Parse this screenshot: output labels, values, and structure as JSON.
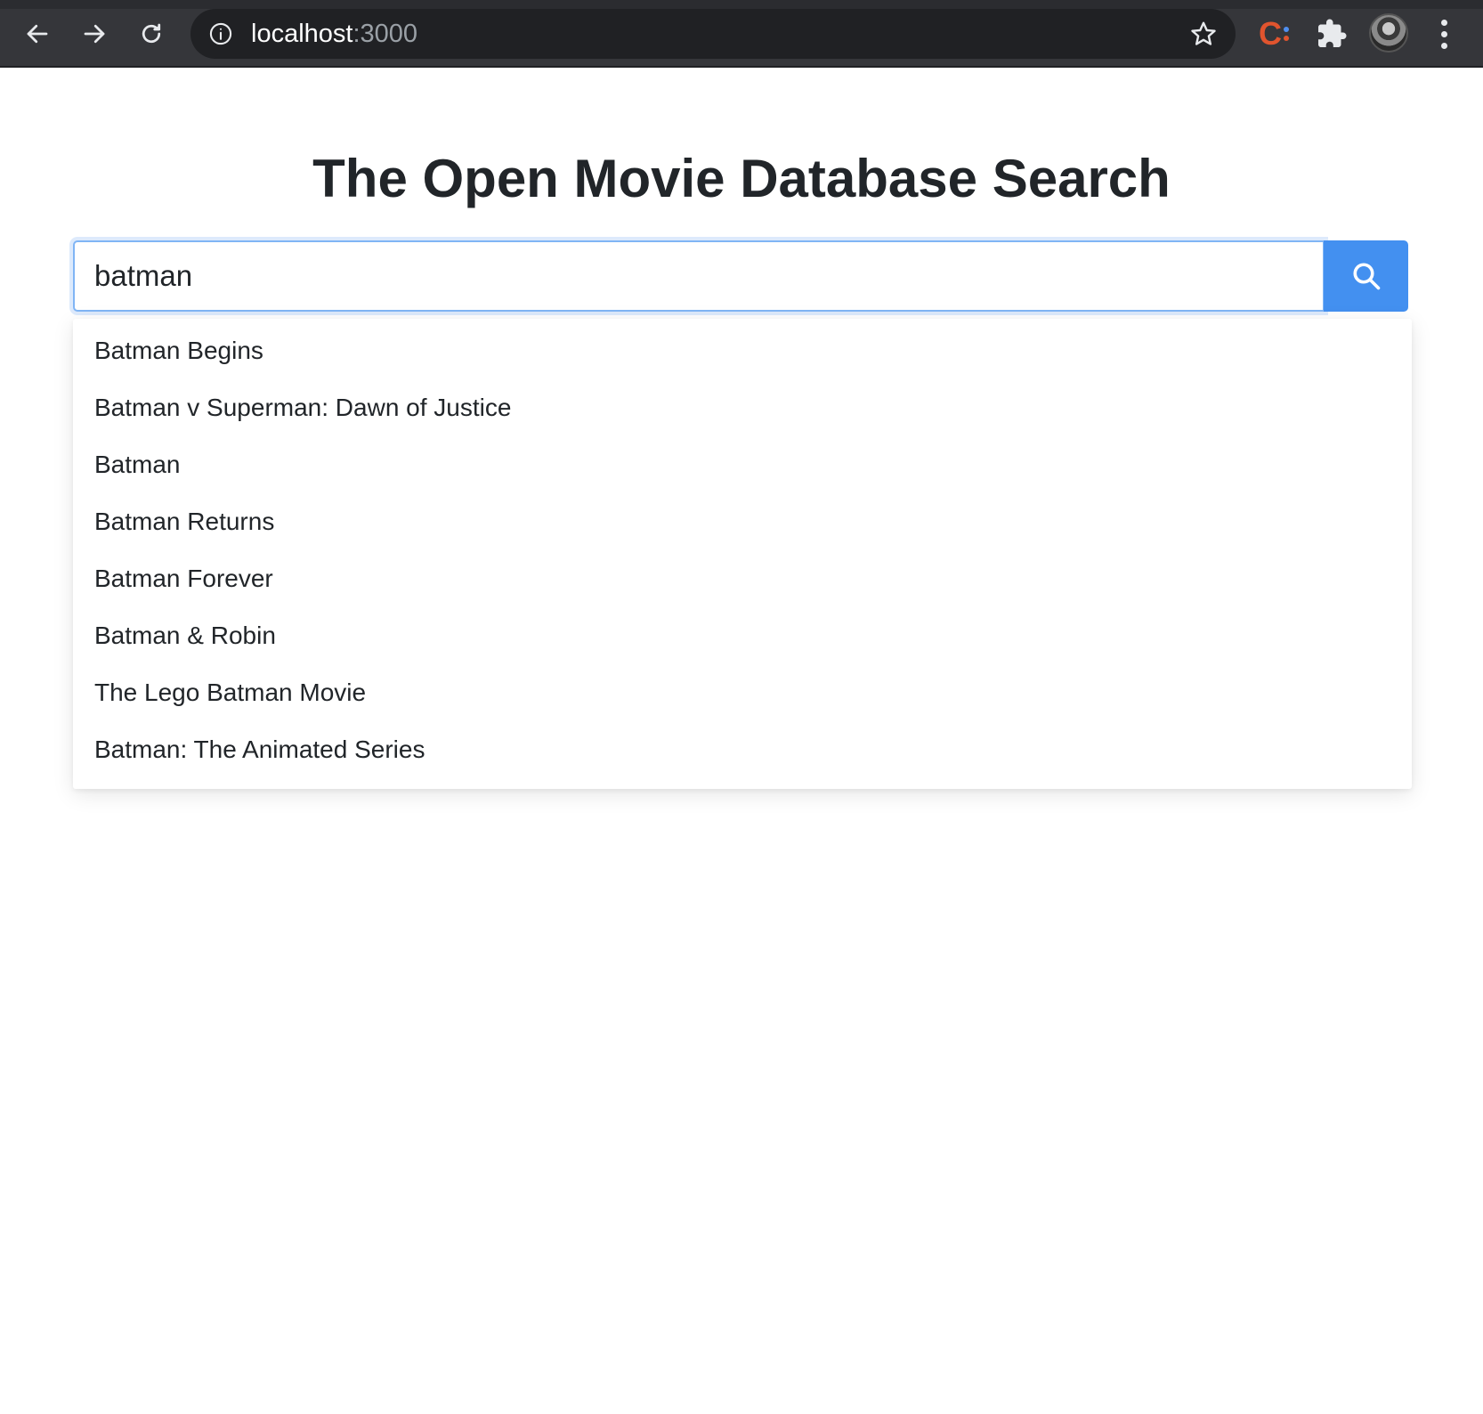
{
  "browser": {
    "url_host": "localhost",
    "url_port": ":3000",
    "icons": [
      "back-arrow",
      "forward-arrow",
      "reload",
      "info",
      "star",
      "extension-c",
      "puzzle",
      "avatar",
      "kebab-menu"
    ]
  },
  "page": {
    "title": "The Open Movie Database Search"
  },
  "search": {
    "value": "batman",
    "button_icon": "search-icon",
    "accent_color": "#4390f0"
  },
  "suggestions": [
    "Batman Begins",
    "Batman v Superman: Dawn of Justice",
    "Batman",
    "Batman Returns",
    "Batman Forever",
    "Batman & Robin",
    "The Lego Batman Movie",
    "Batman: The Animated Series"
  ]
}
